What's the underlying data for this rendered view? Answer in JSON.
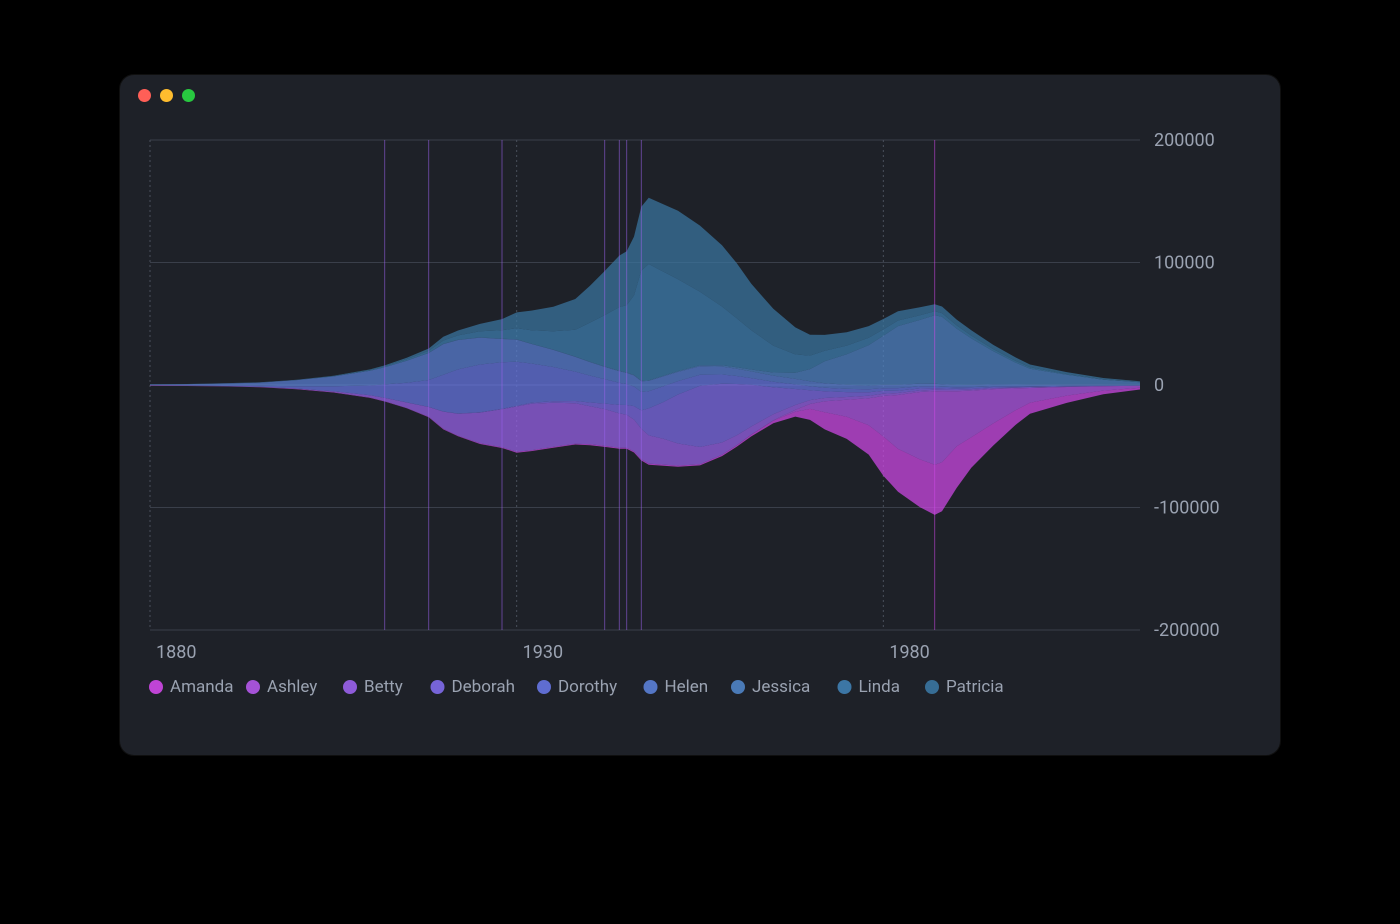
{
  "window": {
    "title": ""
  },
  "chart_data": {
    "type": "area",
    "stack_offset": "wiggle",
    "xlabel": "",
    "ylabel": "",
    "x_ticks": [
      1880,
      1930,
      1980
    ],
    "y_ticks": [
      -200000,
      -100000,
      0,
      100000,
      200000
    ],
    "xlim": [
      1880,
      2015
    ],
    "ylim": [
      -200000,
      200000
    ],
    "legend_position": "bottom",
    "series": [
      {
        "name": "Amanda",
        "color": "#d048e8"
      },
      {
        "name": "Ashley",
        "color": "#b458ea"
      },
      {
        "name": "Betty",
        "color": "#9a62ec"
      },
      {
        "name": "Deborah",
        "color": "#7f6ceb"
      },
      {
        "name": "Dorothy",
        "color": "#6676e3"
      },
      {
        "name": "Helen",
        "color": "#5a7fd6"
      },
      {
        "name": "Jessica",
        "color": "#4f84c6"
      },
      {
        "name": "Linda",
        "color": "#3f7fb2"
      },
      {
        "name": "Patricia",
        "color": "#3a76a1"
      }
    ],
    "years": [
      1880,
      1885,
      1890,
      1895,
      1900,
      1905,
      1910,
      1912,
      1915,
      1918,
      1920,
      1922,
      1925,
      1928,
      1930,
      1932,
      1935,
      1938,
      1940,
      1942,
      1944,
      1945,
      1946,
      1947,
      1948,
      1950,
      1952,
      1955,
      1958,
      1960,
      1962,
      1965,
      1968,
      1970,
      1972,
      1975,
      1978,
      1980,
      1982,
      1985,
      1987,
      1988,
      1990,
      1992,
      1995,
      1998,
      2000,
      2005,
      2010,
      2015
    ],
    "values": {
      "Amanda": [
        200,
        200,
        200,
        200,
        300,
        300,
        300,
        300,
        300,
        400,
        500,
        500,
        600,
        600,
        700,
        700,
        700,
        700,
        800,
        800,
        800,
        800,
        900,
        900,
        900,
        1000,
        1000,
        1000,
        1100,
        1200,
        1400,
        2000,
        4000,
        9000,
        14000,
        18000,
        24000,
        32000,
        35000,
        39000,
        41000,
        40000,
        34000,
        25000,
        18000,
        12000,
        9000,
        6000,
        3000,
        1500
      ],
      "Ashley": [
        0,
        0,
        0,
        0,
        0,
        0,
        0,
        0,
        0,
        0,
        0,
        0,
        0,
        0,
        0,
        0,
        0,
        0,
        0,
        0,
        0,
        0,
        0,
        0,
        0,
        0,
        0,
        0,
        0,
        100,
        200,
        400,
        1500,
        4000,
        9000,
        14000,
        22000,
        33000,
        44000,
        55000,
        60000,
        58000,
        45000,
        38000,
        28000,
        18000,
        12000,
        7000,
        3500,
        1500
      ],
      "Betty": [
        100,
        100,
        150,
        200,
        400,
        800,
        1800,
        2600,
        4500,
        8000,
        14000,
        18000,
        25000,
        31000,
        37000,
        38000,
        36000,
        33000,
        31000,
        30000,
        28000,
        27000,
        26000,
        25000,
        23000,
        21000,
        18000,
        14000,
        10000,
        8000,
        6500,
        5000,
        4000,
        3200,
        2600,
        2200,
        2000,
        1800,
        1600,
        1300,
        1100,
        1050,
        950,
        850,
        650,
        500,
        400,
        250,
        150,
        80
      ],
      "Deborah": [
        0,
        0,
        0,
        0,
        0,
        0,
        20,
        30,
        50,
        80,
        120,
        160,
        250,
        400,
        600,
        800,
        1200,
        1800,
        3000,
        4500,
        7000,
        8000,
        11000,
        15000,
        22000,
        30000,
        40000,
        50000,
        48000,
        42000,
        34000,
        22000,
        13000,
        8000,
        5500,
        4000,
        3000,
        2400,
        2000,
        1600,
        1300,
        1200,
        1000,
        900,
        700,
        550,
        450,
        300,
        180,
        100
      ],
      "Dorothy": [
        100,
        200,
        400,
        800,
        1800,
        4000,
        8000,
        11000,
        16000,
        22000,
        30000,
        36000,
        39000,
        38000,
        36000,
        32000,
        28000,
        24000,
        22000,
        20000,
        18000,
        17000,
        16000,
        15000,
        14000,
        13000,
        11000,
        9000,
        7500,
        6500,
        5500,
        4500,
        3800,
        3300,
        2900,
        2600,
        2400,
        2200,
        2000,
        1700,
        1500,
        1400,
        1200,
        1100,
        900,
        700,
        600,
        400,
        250,
        150
      ],
      "Helen": [
        600,
        1000,
        1600,
        2600,
        5000,
        8000,
        12000,
        14000,
        18000,
        22000,
        25000,
        24000,
        22000,
        19000,
        18000,
        16000,
        14000,
        12000,
        11000,
        10000,
        9500,
        9200,
        9000,
        8800,
        8500,
        8000,
        7500,
        7000,
        6500,
        6000,
        5500,
        5000,
        4500,
        4000,
        3600,
        3300,
        3000,
        2800,
        2600,
        2300,
        2100,
        2050,
        1900,
        1800,
        1600,
        1400,
        1300,
        1000,
        800,
        600
      ],
      "Jessica": [
        50,
        50,
        60,
        70,
        80,
        90,
        100,
        110,
        120,
        130,
        150,
        160,
        180,
        200,
        220,
        230,
        240,
        260,
        280,
        300,
        320,
        330,
        350,
        380,
        420,
        500,
        600,
        800,
        1000,
        1200,
        1500,
        2500,
        5000,
        10000,
        18000,
        25000,
        33000,
        40000,
        48000,
        52000,
        56000,
        55000,
        46000,
        38000,
        27000,
        18000,
        13000,
        8000,
        4000,
        2000
      ],
      "Linda": [
        30,
        40,
        60,
        90,
        150,
        250,
        500,
        700,
        1200,
        1800,
        2800,
        3600,
        5000,
        7000,
        9000,
        11000,
        15000,
        22000,
        32000,
        42000,
        52000,
        55000,
        65000,
        90000,
        95000,
        85000,
        75000,
        60000,
        48000,
        40000,
        32000,
        22000,
        15000,
        11000,
        8500,
        7000,
        6000,
        5200,
        4600,
        3800,
        3200,
        3000,
        2600,
        2300,
        1800,
        1400,
        1100,
        700,
        450,
        250
      ],
      "Patricia": [
        30,
        40,
        60,
        90,
        150,
        250,
        500,
        700,
        1200,
        1800,
        3000,
        4000,
        6000,
        9000,
        13000,
        16000,
        20000,
        25000,
        30000,
        36000,
        42000,
        44000,
        48000,
        52000,
        54000,
        55000,
        56000,
        54000,
        50000,
        45000,
        38000,
        30000,
        22000,
        17000,
        13000,
        11000,
        9500,
        8500,
        7600,
        6500,
        5700,
        5400,
        4800,
        4300,
        3500,
        2800,
        2300,
        1500,
        900,
        500
      ]
    },
    "spikes_x": [
      1912,
      1918,
      1928,
      1942,
      1944,
      1945,
      1947,
      1987
    ]
  }
}
